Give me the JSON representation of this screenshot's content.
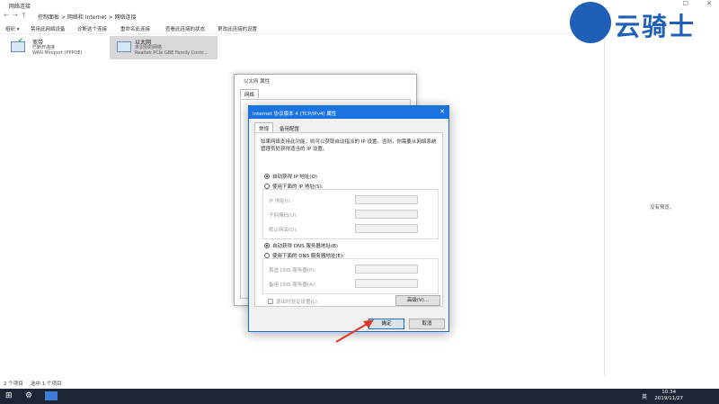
{
  "window": {
    "title": "网络连接"
  },
  "address": {
    "crumbs": [
      "控制面板",
      "网络和 Internet",
      "网络连接"
    ],
    "separator": ">"
  },
  "toolbar": {
    "items": [
      "组织 ▾",
      "禁用此网络设备",
      "诊断这个连接",
      "重命名此连接",
      "查看此连接的状态",
      "更改此连接的设置"
    ]
  },
  "connections": [
    {
      "name": "宽带",
      "status": "已断开连接",
      "device": "WAN Miniport (PPPOE)"
    },
    {
      "name": "以太网",
      "status": "未识别的网络",
      "device": "Realtek PCIe GBE Family Contr..."
    }
  ],
  "preview": {
    "message": "没有预览。"
  },
  "status_bar": {
    "count": "2 个项目",
    "selected": "选中 1 个项目"
  },
  "taskbar": {
    "time": "10:34",
    "date": "2019/11/27",
    "tray_ime": "英"
  },
  "ethernet_dialog": {
    "title": "以太网 属性",
    "tab": "网络"
  },
  "ipv4_dialog": {
    "title": "Internet 协议版本 4 (TCP/IPv4) 属性",
    "close": "✕",
    "tabs": [
      "常规",
      "备用配置"
    ],
    "description": "如果网络支持此功能，则可以获取自动指派的 IP 设置。否则，你需要从网络系统管理员处获得适当的 IP 设置。",
    "auto_ip": "自动获得 IP 地址(O)",
    "manual_ip": "使用下面的 IP 地址(S):",
    "ip_address_label": "IP 地址(I):",
    "subnet_label": "子网掩码(U):",
    "gateway_label": "默认网关(D):",
    "auto_dns": "自动获得 DNS 服务器地址(B)",
    "manual_dns": "使用下面的 DNS 服务器地址(E):",
    "preferred_dns_label": "首选 DNS 服务器(P):",
    "alternate_dns_label": "备用 DNS 服务器(A):",
    "validate_label": "退出时验证设置(L)",
    "advanced_button": "高级(V)...",
    "ok_button": "确定",
    "cancel_button": "取消"
  },
  "watermark": {
    "text": "云骑士"
  },
  "colors": {
    "title_blue": "#1a73e0",
    "taskbar": "#1b2533",
    "arrow_red": "#e0352b"
  }
}
